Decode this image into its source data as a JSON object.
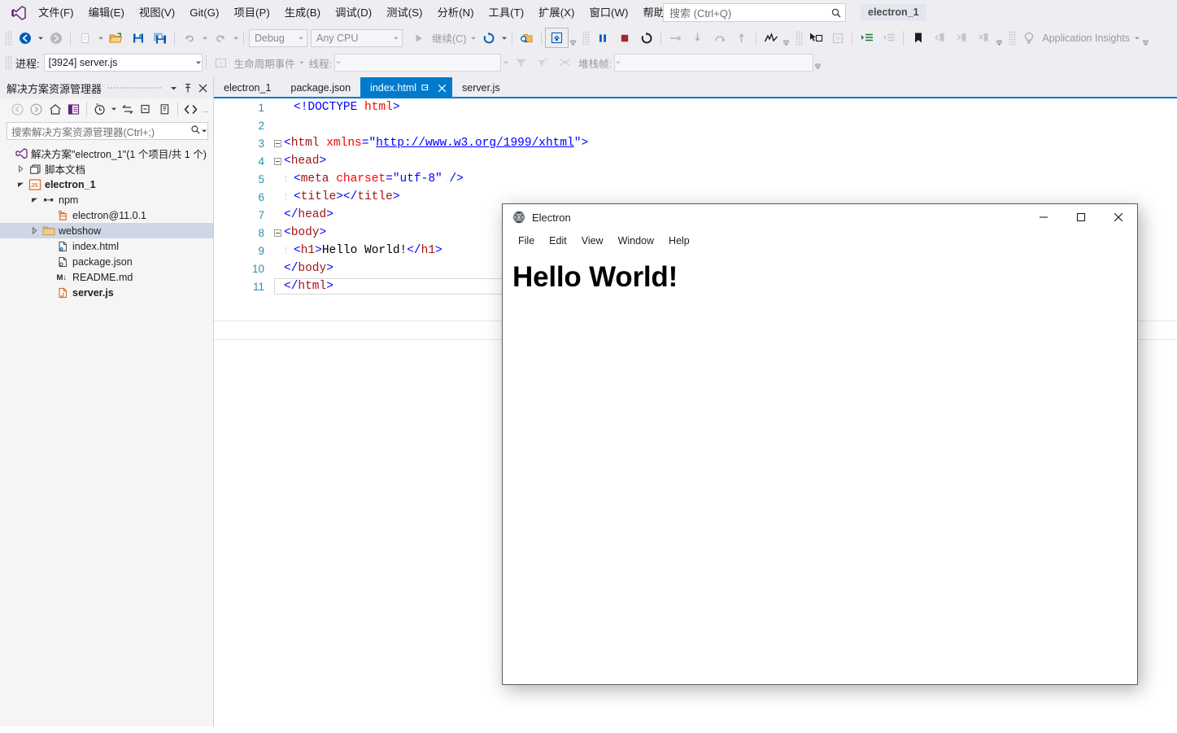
{
  "app": {
    "title": "Visual Studio",
    "project_chip": "electron_1"
  },
  "menubar": {
    "items": [
      {
        "label": "文件(F)",
        "name": "menu-file"
      },
      {
        "label": "编辑(E)",
        "name": "menu-edit"
      },
      {
        "label": "视图(V)",
        "name": "menu-view"
      },
      {
        "label": "Git(G)",
        "name": "menu-git"
      },
      {
        "label": "项目(P)",
        "name": "menu-project"
      },
      {
        "label": "生成(B)",
        "name": "menu-build"
      },
      {
        "label": "调试(D)",
        "name": "menu-debug"
      },
      {
        "label": "测试(S)",
        "name": "menu-test"
      },
      {
        "label": "分析(N)",
        "name": "menu-analyze"
      },
      {
        "label": "工具(T)",
        "name": "menu-tools"
      },
      {
        "label": "扩展(X)",
        "name": "menu-extensions"
      },
      {
        "label": "窗口(W)",
        "name": "menu-window"
      },
      {
        "label": "帮助(H)",
        "name": "menu-help"
      }
    ]
  },
  "search": {
    "placeholder": "搜索 (Ctrl+Q)",
    "value": ""
  },
  "toolbar": {
    "config_value": "Debug",
    "platform_value": "Any CPU",
    "run_label": "继续(C)",
    "app_insights_label": "Application Insights"
  },
  "debug_toolbar": {
    "process_label": "进程:",
    "process_value": "[3924] server.js",
    "lifecycle_label": "生命周期事件",
    "thread_label": "线程:",
    "thread_value": "",
    "stackframe_label": "堆栈帧:",
    "stackframe_value": ""
  },
  "solution_explorer": {
    "title": "解决方案资源管理器",
    "search_placeholder": "搜索解决方案资源管理器(Ctrl+;)",
    "tree": [
      {
        "label": "解决方案\"electron_1\"(1 个项目/共 1 个)",
        "icon": "solution-icon",
        "indent": 0,
        "arrow": "none",
        "bold": false,
        "selected": false,
        "name": "tree-item-solution"
      },
      {
        "label": "脚本文档",
        "icon": "script-docs-icon",
        "indent": 1,
        "arrow": "collapsed",
        "bold": false,
        "selected": false,
        "name": "tree-item-script-documents"
      },
      {
        "label": "electron_1",
        "icon": "js-project-icon",
        "indent": 1,
        "arrow": "expanded",
        "bold": true,
        "selected": false,
        "name": "tree-item-electron-1"
      },
      {
        "label": "npm",
        "icon": "npm-icon",
        "indent": 2,
        "arrow": "expanded",
        "bold": false,
        "selected": false,
        "name": "tree-item-npm"
      },
      {
        "label": "electron@11.0.1",
        "icon": "package-icon",
        "indent": 3,
        "arrow": "none",
        "bold": false,
        "selected": false,
        "name": "tree-item-electron-package"
      },
      {
        "label": "webshow",
        "icon": "folder-icon",
        "indent": 2,
        "arrow": "collapsed",
        "bold": false,
        "selected": true,
        "name": "tree-item-webshow"
      },
      {
        "label": "index.html",
        "icon": "html-file-icon",
        "indent": 3,
        "arrow": "none",
        "bold": false,
        "selected": false,
        "name": "tree-item-index-html"
      },
      {
        "label": "package.json",
        "icon": "json-file-icon",
        "indent": 3,
        "arrow": "none",
        "bold": false,
        "selected": false,
        "name": "tree-item-package-json"
      },
      {
        "label": "README.md",
        "icon": "markdown-file-icon",
        "indent": 3,
        "arrow": "none",
        "bold": false,
        "selected": false,
        "name": "tree-item-readme-md"
      },
      {
        "label": "server.js",
        "icon": "js-file-icon",
        "indent": 3,
        "arrow": "none",
        "bold": true,
        "selected": false,
        "name": "tree-item-server-js"
      }
    ]
  },
  "editor": {
    "tabs": [
      {
        "label": "electron_1",
        "active": false,
        "name": "tab-electron-1"
      },
      {
        "label": "package.json",
        "active": false,
        "name": "tab-package-json"
      },
      {
        "label": "index.html",
        "active": true,
        "name": "tab-index-html"
      },
      {
        "label": "server.js",
        "active": false,
        "name": "tab-server-js"
      }
    ],
    "line_numbers": [
      "1",
      "2",
      "3",
      "4",
      "5",
      "6",
      "7",
      "8",
      "9",
      "10",
      "11"
    ],
    "code": {
      "l1": "<!DOCTYPE html>",
      "l3_a": "<html xmlns=",
      "l3_q1": "\"",
      "l3_url": "http://www.w3.org/1999/xhtml",
      "l3_q2": "\"",
      "l3_b": ">",
      "l4": "<head>",
      "l5_a": "<meta ",
      "l5_attr": "charset",
      "l5_eq": "=",
      "l5_val": "\"utf-8\"",
      "l5_b": " />",
      "l6": "<title></title>",
      "l7": "</head>",
      "l8": "<body>",
      "l9_open": "<h1>",
      "l9_text": "Hello World!",
      "l9_close": "</h1>",
      "l10": "</body>",
      "l11": "</html>"
    }
  },
  "electron_window": {
    "title": "Electron",
    "menu": [
      "File",
      "Edit",
      "View",
      "Window",
      "Help"
    ],
    "heading": "Hello World!",
    "controls": {
      "minimize": "minimize-icon",
      "maximize": "maximize-icon",
      "close": "close-icon"
    }
  },
  "colors": {
    "accent": "#007acc",
    "chrome": "#eeeef2",
    "selection": "#cfd6e5",
    "tag": "#a31515",
    "attr": "#ff0000",
    "value": "#0000ff",
    "linenum": "#2b91af"
  }
}
